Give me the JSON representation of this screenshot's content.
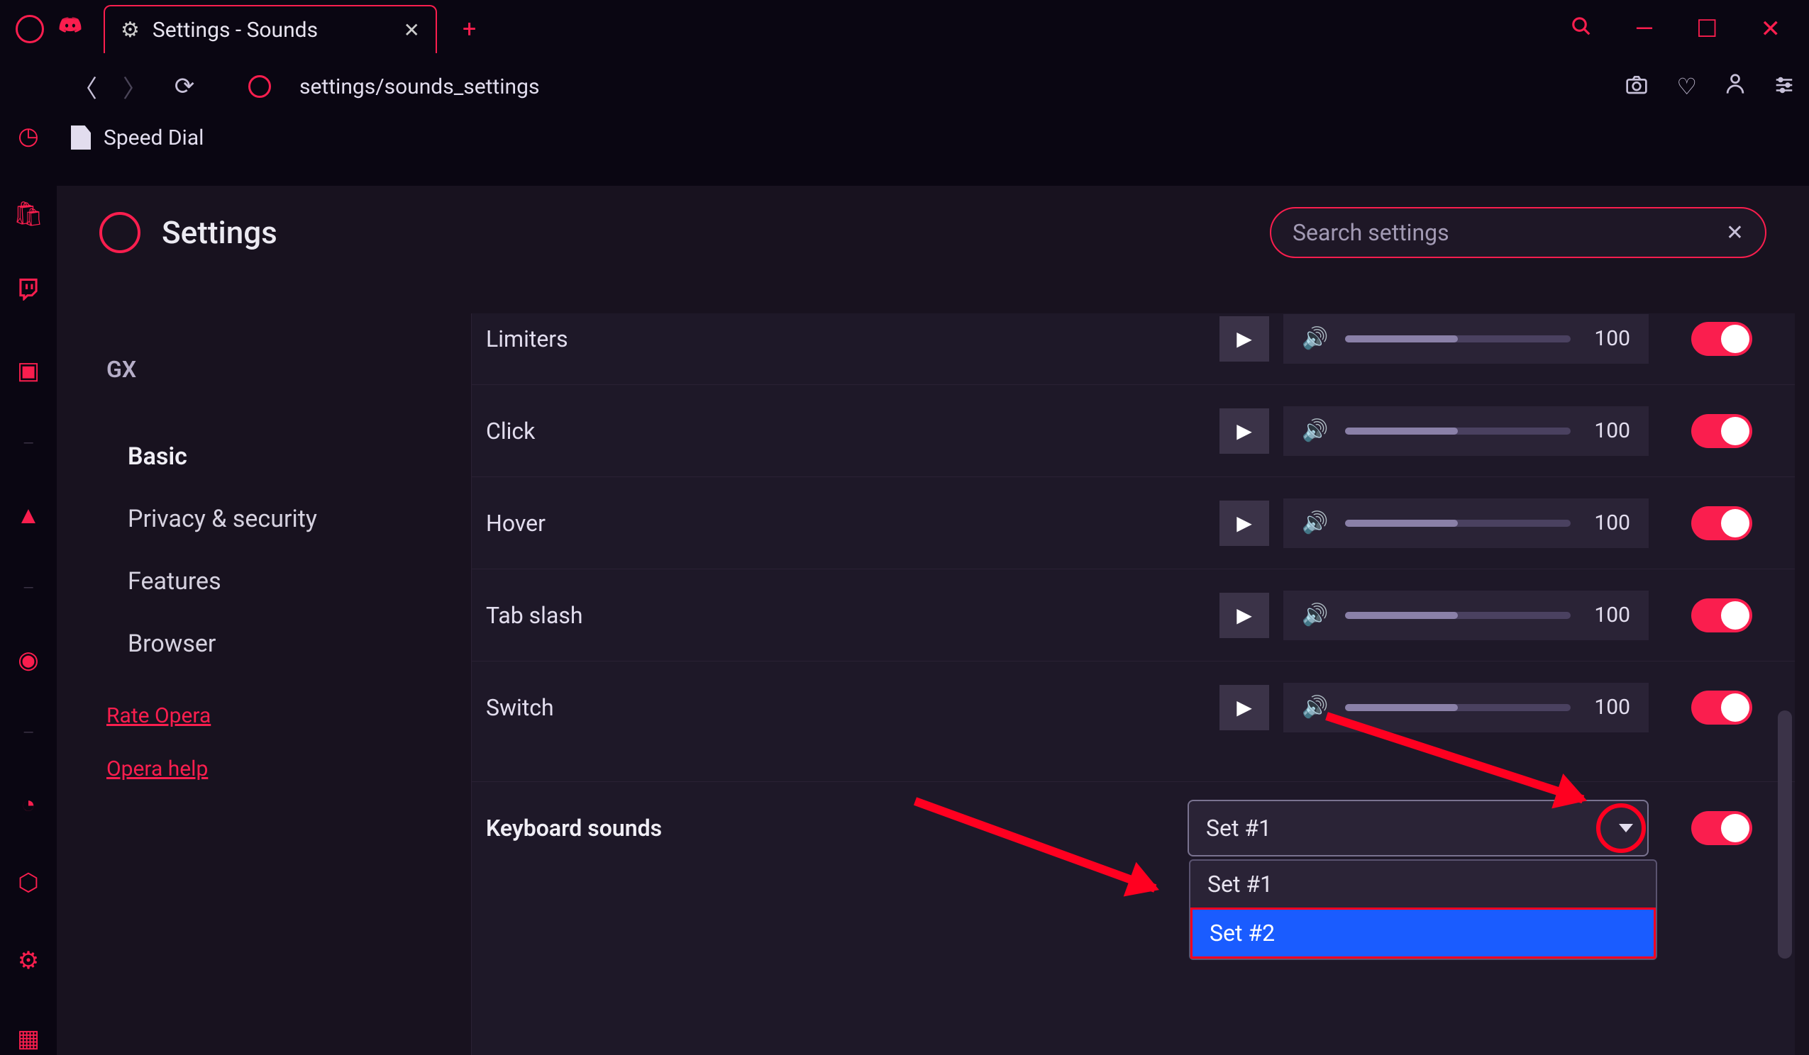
{
  "window": {
    "tab_title": "Settings - Sounds",
    "new_tab": "+"
  },
  "addressbar": {
    "url": "settings/sounds_settings"
  },
  "bookmarks": {
    "speed_dial": "Speed Dial"
  },
  "settings_header": {
    "title": "Settings",
    "search_placeholder": "Search settings"
  },
  "sidenav": {
    "section": "GX",
    "items": [
      "Basic",
      "Privacy & security",
      "Features",
      "Browser"
    ],
    "active_index": 0,
    "links": [
      "Rate Opera",
      "Opera help"
    ]
  },
  "sounds": [
    {
      "label": "Limiters",
      "volume": 100,
      "enabled": true
    },
    {
      "label": "Click",
      "volume": 100,
      "enabled": true
    },
    {
      "label": "Hover",
      "volume": 100,
      "enabled": true
    },
    {
      "label": "Tab slash",
      "volume": 100,
      "enabled": true
    },
    {
      "label": "Switch",
      "volume": 100,
      "enabled": true
    }
  ],
  "keyboard_sounds": {
    "label": "Keyboard sounds",
    "selected": "Set #1",
    "options": [
      "Set #1",
      "Set #2"
    ],
    "highlighted_index": 1,
    "enabled": true
  }
}
